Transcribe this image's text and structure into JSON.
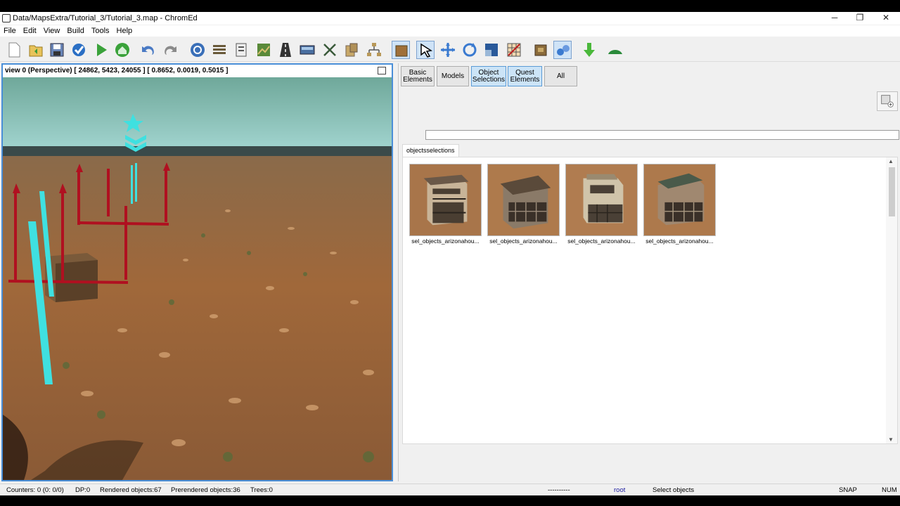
{
  "window": {
    "title": "Data/MapsExtra/Tutorial_3/Tutorial_3.map - ChromEd",
    "minimize": "─",
    "maximize": "❐",
    "close": "✕"
  },
  "menu": [
    "File",
    "Edit",
    "View",
    "Build",
    "Tools",
    "Help"
  ],
  "viewport": {
    "header": "view 0 (Perspective) [  24862,   5423,  24055 ] [ 0.8652, 0.0019, 0.5015 ]"
  },
  "categories": [
    {
      "line1": "Basic",
      "line2": "Elements"
    },
    {
      "line1": "Models",
      "line2": ""
    },
    {
      "line1": "Object",
      "line2": "Selections"
    },
    {
      "line1": "Quest",
      "line2": "Elements"
    },
    {
      "line1": "All",
      "line2": ""
    }
  ],
  "search": {
    "value": ""
  },
  "collection_tab": "objectsselections",
  "thumbnails": [
    {
      "label": "sel_objects_arizonahou..."
    },
    {
      "label": "sel_objects_arizonahou..."
    },
    {
      "label": "sel_objects_arizonahou..."
    },
    {
      "label": "sel_objects_arizonahou..."
    }
  ],
  "status": {
    "counters": "Counters: 0  (0: 0/0)",
    "dp": "DP:0",
    "rendered": "Rendered objects:67",
    "prerendered": "Prerendered objects:36",
    "trees": "Trees:0",
    "dashes": "----------",
    "root": "root",
    "mode": "Select objects",
    "snap": "SNAP",
    "num": "NUM"
  },
  "colors": {
    "accent": "#4a8fd8",
    "selected_tab": "#cce4f7",
    "root_text": "#1a1aa0"
  }
}
